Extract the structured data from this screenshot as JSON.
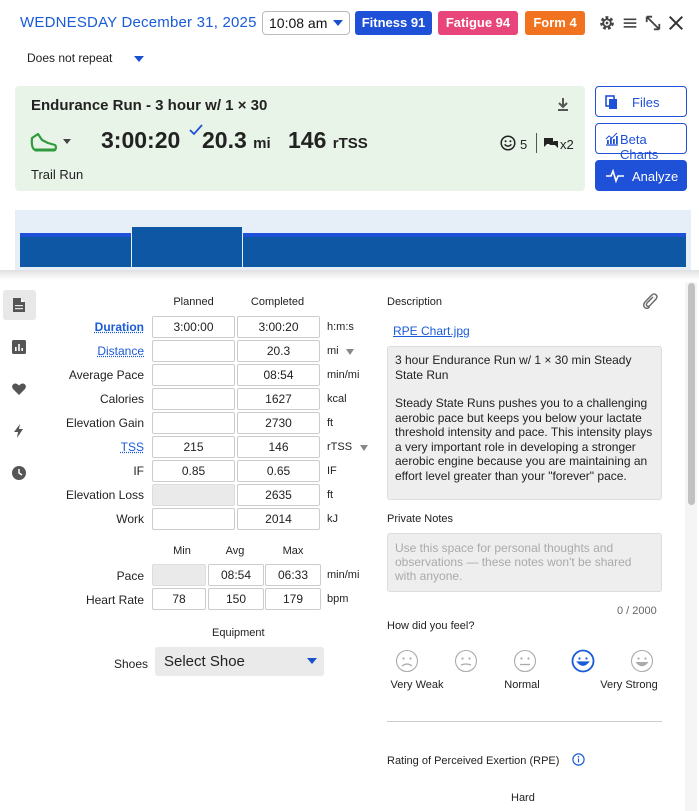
{
  "header": {
    "date": "WEDNESDAY December 31, 2025",
    "time": "10:08 am",
    "fitness": "Fitness 91",
    "fatigue": "Fatigue 94",
    "form": "Form 4",
    "repeat": "Does not repeat",
    "colors": {
      "fitness": "#1f50d8",
      "fatigue": "#e8457a",
      "form": "#f2731f",
      "accent": "#1a5bd8"
    },
    "icons": [
      "gear-icon",
      "menu-icon",
      "expand-icon",
      "close-icon"
    ]
  },
  "workout": {
    "title": "Endurance Run - 3 hour w/ 1 × 30",
    "duration": "3:00:20",
    "distance": "20.3",
    "distance_unit": "mi",
    "tss": "146",
    "tss_unit": "rTSS",
    "feel_count": "5",
    "comment_count": "x2",
    "sport": "Trail Run"
  },
  "side_buttons": {
    "files": "Files",
    "beta_charts": "Beta Charts",
    "analyze": "Analyze"
  },
  "table": {
    "col_planned": "Planned",
    "col_completed": "Completed",
    "rows": [
      {
        "label": "Duration",
        "planned": "3:00:00",
        "completed": "3:00:20",
        "unit": "h:m:s"
      },
      {
        "label": "Distance",
        "planned": "",
        "completed": "20.3",
        "unit": "mi"
      },
      {
        "label": "Average Pace",
        "planned": "",
        "completed": "08:54",
        "unit": "min/mi"
      },
      {
        "label": "Calories",
        "planned": "",
        "completed": "1627",
        "unit": "kcal"
      },
      {
        "label": "Elevation Gain",
        "planned": "",
        "completed": "2730",
        "unit": "ft"
      },
      {
        "label": "TSS",
        "planned": "215",
        "completed": "146",
        "unit": "rTSS"
      },
      {
        "label": "IF",
        "planned": "0.85",
        "completed": "0.65",
        "unit": "IF"
      },
      {
        "label": "Elevation Loss",
        "planned": "",
        "completed": "2635",
        "unit": "ft"
      },
      {
        "label": "Work",
        "planned": "",
        "completed": "2014",
        "unit": "kJ"
      }
    ]
  },
  "mam": {
    "col_min": "Min",
    "col_avg": "Avg",
    "col_max": "Max",
    "rows": [
      {
        "label": "Pace",
        "min": "",
        "avg": "08:54",
        "max": "06:33",
        "unit": "min/mi"
      },
      {
        "label": "Heart Rate",
        "min": "78",
        "avg": "150",
        "max": "179",
        "unit": "bpm"
      }
    ]
  },
  "equipment": {
    "heading": "Equipment",
    "shoes_label": "Shoes",
    "shoes_value": "Select Shoe"
  },
  "description": {
    "heading": "Description",
    "attachment": "RPE Chart.jpg",
    "para1": "3 hour Endurance Run w/ 1 × 30 min Steady State Run",
    "para2": "Steady State Runs pushes you to a challenging aerobic pace but keeps you below your lactate threshold intensity and pace. This intensity plays a very important role in developing a stronger aerobic engine because you are maintaining an effort level greater than your \"forever\" pace."
  },
  "private_notes": {
    "heading": "Private Notes",
    "placeholder": "Use this space for personal thoughts and observations — these notes won't be shared with anyone.",
    "counter": "0 / 2000"
  },
  "feel": {
    "heading": "How did you feel?",
    "labels": [
      "Very Weak",
      "Normal",
      "Very Strong"
    ],
    "selected_index": 3
  },
  "rpe": {
    "heading": "Rating of Perceived Exertion (RPE)",
    "value_label": "Hard"
  },
  "graph": {
    "segments": [
      {
        "label": "",
        "level": 0.45
      },
      {
        "label": "",
        "level": 0.65
      },
      {
        "label": "",
        "level": 0.45
      }
    ],
    "bar_color": "#0d57a4",
    "line_color": "#1f50d8"
  }
}
